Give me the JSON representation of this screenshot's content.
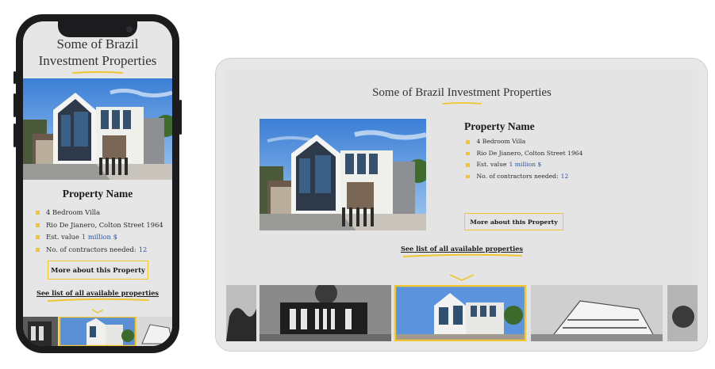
{
  "mobile": {
    "title_line1": "Some of Brazil",
    "title_line2": "Investment Properties",
    "property_name": "Property Name",
    "details": {
      "type": "4 Bedroom Villa",
      "address": "Rio De Jianero, Colton Street 1964",
      "value_prefix": "Est. value ",
      "value_highlight": "1 million $",
      "contractors_prefix": "No. of contractors needed: ",
      "contractors_highlight": "12"
    },
    "more_button": "More about this Property",
    "see_list_link": "See list of all available properties"
  },
  "tablet": {
    "title": "Some of Brazil Investment Properties",
    "property_name": "Property Name",
    "details": {
      "type": "4 Bedroom Villa",
      "address": "Rio De Jianero, Colton Street 1964",
      "value_prefix": "Est. value ",
      "value_highlight": "1 million $",
      "contractors_prefix": "No. of contractors needed: ",
      "contractors_highlight": "12"
    },
    "more_button": "More about this Property",
    "see_list_link": "See list of all available properties"
  },
  "colors": {
    "accent_yellow": "#f0c530",
    "highlight_blue": "#2b56a8",
    "screen_bg": "#e6e6e6",
    "device_frame": "#1c1c1e"
  },
  "icons": [
    "bullet-square-icon",
    "chevron-down-icon"
  ]
}
